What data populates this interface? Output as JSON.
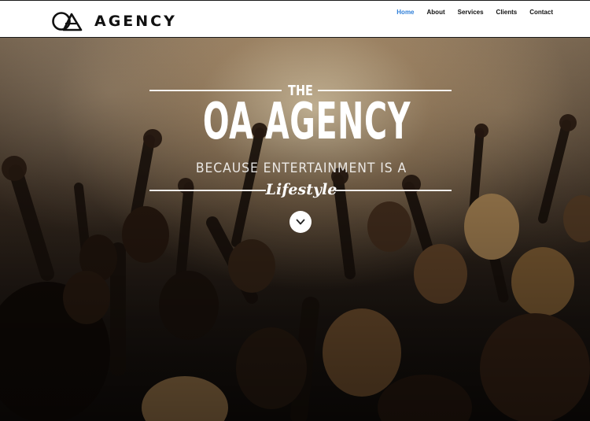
{
  "header": {
    "logo_text": "AGENCY",
    "logo_mark": "oa-logo-mark",
    "nav": [
      {
        "label": "Home",
        "active": true
      },
      {
        "label": "About",
        "active": false
      },
      {
        "label": "Services",
        "active": false
      },
      {
        "label": "Clients",
        "active": false
      },
      {
        "label": "Contact",
        "active": false
      }
    ]
  },
  "hero": {
    "kicker": "THE",
    "title": "OA AGENCY",
    "subtitle": "BECAUSE ENTERTAINMENT IS A",
    "tagline": "Lifestyle",
    "scroll_icon": "chevron-down-icon",
    "background": "concert-crowd-photo"
  },
  "colors": {
    "nav_active": "#2f7fd8",
    "nav_text": "#111111",
    "header_bg": "#ffffff"
  }
}
